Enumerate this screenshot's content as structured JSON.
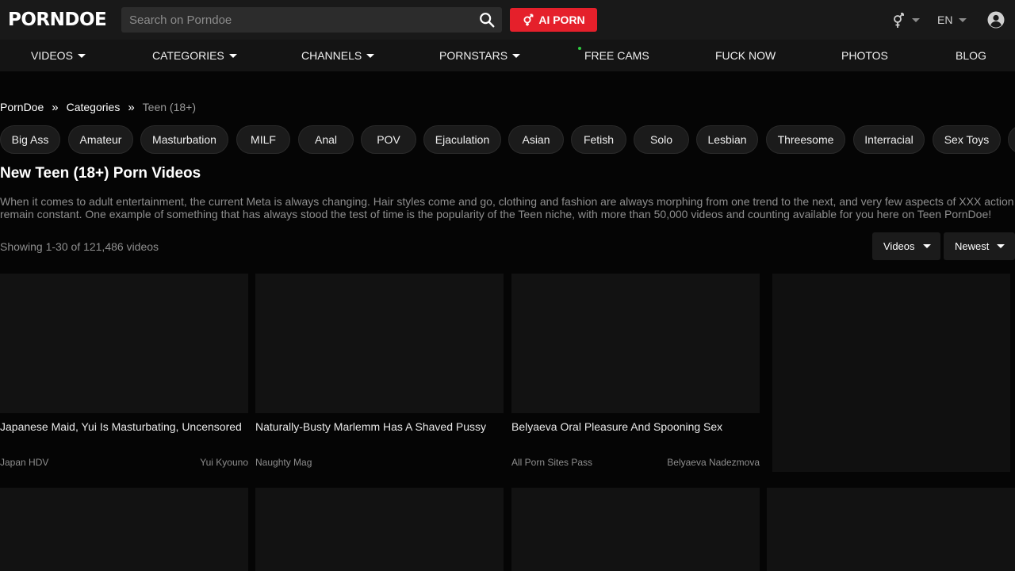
{
  "header": {
    "logo_porn": "PORN",
    "logo_doe": "DOE",
    "search_placeholder": "Search on Porndoe",
    "ai_button": "AI PORN",
    "language": "EN"
  },
  "nav": [
    {
      "label": "VIDEOS",
      "dropdown": true
    },
    {
      "label": "CATEGORIES",
      "dropdown": true
    },
    {
      "label": "CHANNELS",
      "dropdown": true
    },
    {
      "label": "PORNSTARS",
      "dropdown": true
    },
    {
      "label": "FREE CAMS",
      "dropdown": false,
      "live_dot": true
    },
    {
      "label": "FUCK NOW",
      "dropdown": false
    },
    {
      "label": "PHOTOS",
      "dropdown": false
    },
    {
      "label": "BLOG",
      "dropdown": false
    }
  ],
  "breadcrumb": {
    "home": "PornDoe",
    "sep": "»",
    "categories": "Categories",
    "current": "Teen (18+)"
  },
  "tags": [
    "Big Ass",
    "Amateur",
    "Masturbation",
    "MILF",
    "Anal",
    "POV",
    "Ejaculation",
    "Asian",
    "Fetish",
    "Solo",
    "Lesbian",
    "Threesome",
    "Interracial",
    "Sex Toys"
  ],
  "page": {
    "title": "New Teen (18+) Porn Videos",
    "description": "When it comes to adult entertainment, the current Meta is always changing. Hair styles come and go, clothing and fashion are always morphing from one trend to the next, and very few aspects of XXX action remain constant. One example of something that has always stood the test of time is the popularity of the Teen niche, with more than 50,000 videos and counting available for you here on Teen PornDoe!",
    "showing": "Showing 1-30 of 121,486 videos",
    "filter_type": "Videos",
    "filter_sort": "Newest"
  },
  "videos": [
    {
      "title": "Japanese Maid, Yui Is Masturbating, Uncensored",
      "channel": "Japan HDV",
      "star": "Yui Kyouno"
    },
    {
      "title": "Naturally-Busty Marlemm Has A Shaved Pussy",
      "channel": "Naughty Mag",
      "star": ""
    },
    {
      "title": "Belyaeva Oral Pleasure And Spooning Sex",
      "channel": "All Porn Sites Pass",
      "star": "Belyaeva Nadezmova"
    }
  ],
  "colors": {
    "accent": "#e5202b",
    "background": "#050505",
    "topbar": "#191919",
    "live_dot": "#2ecc40"
  }
}
